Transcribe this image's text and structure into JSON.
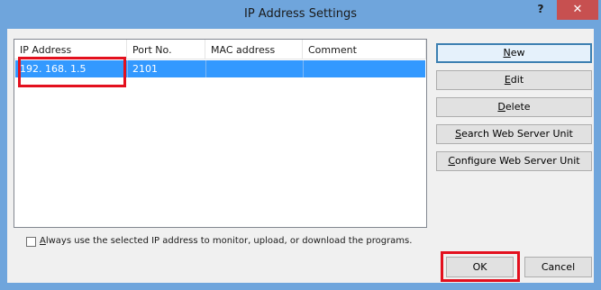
{
  "window": {
    "title": "IP Address Settings",
    "help_label": "?",
    "close_label": "✕"
  },
  "table": {
    "columns": [
      "IP Address",
      "Port No.",
      "MAC address",
      "Comment"
    ],
    "rows": [
      {
        "ip": "192. 168. 1.5",
        "port": "2101",
        "mac": "",
        "comment": ""
      }
    ]
  },
  "buttons": {
    "new": {
      "mnemonic": "N",
      "rest": "ew"
    },
    "edit": {
      "mnemonic": "E",
      "rest": "dit"
    },
    "delete": {
      "mnemonic": "D",
      "rest": "elete"
    },
    "search": {
      "mnemonic": "S",
      "rest": "earch Web Server Unit"
    },
    "configure": {
      "mnemonic": "C",
      "rest": "onfigure Web Server Unit"
    },
    "ok": "OK",
    "cancel": "Cancel"
  },
  "checkbox": {
    "mnemonic": "A",
    "rest": "lways use the selected IP address to monitor, upload, or download the programs.",
    "checked": false
  },
  "colors": {
    "selection": "#3399ff",
    "highlight_box": "#e3101e",
    "titlebar": "#6fa5dc",
    "close_button": "#c75050"
  }
}
